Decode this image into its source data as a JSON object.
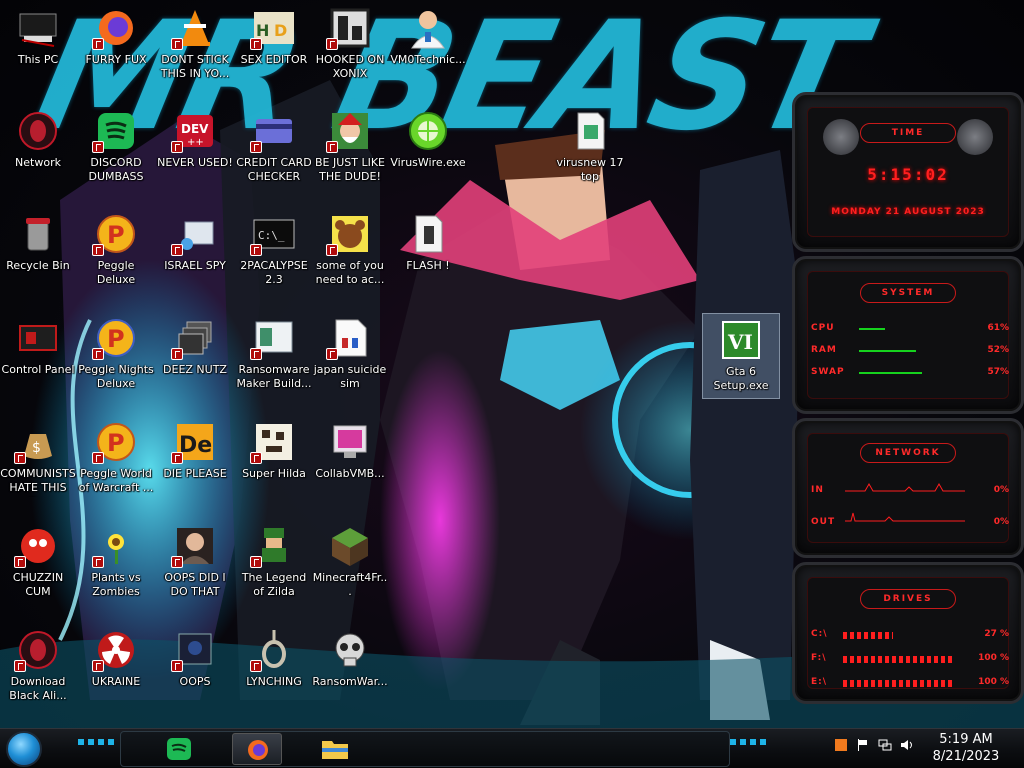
{
  "wallpaper": {
    "title": "MR BEAST"
  },
  "desktop": {
    "icons": [
      {
        "label": "This PC",
        "icon": "this-pc-icon",
        "shortcut": false
      },
      {
        "label": "FURRY FUX",
        "icon": "firefox-icon",
        "shortcut": true
      },
      {
        "label": "DONT STICK THIS IN YO...",
        "icon": "vlc-cone-icon",
        "shortcut": true
      },
      {
        "label": "SEX EDITOR",
        "icon": "hxd-hex-editor-icon",
        "shortcut": true
      },
      {
        "label": "HOOKED ON XONIX",
        "icon": "xonix-game-icon",
        "shortcut": true
      },
      {
        "label": "VM0Technic...",
        "icon": "doctor-avatar-icon",
        "shortcut": false
      },
      {
        "label": "Network",
        "icon": "network-alien-icon",
        "shortcut": false
      },
      {
        "label": "DISCORD DUMBASS",
        "icon": "spotify-icon",
        "shortcut": true
      },
      {
        "label": "NEVER USED!",
        "icon": "dev-cpp-icon",
        "shortcut": true
      },
      {
        "label": "CREDIT CARD CHECKER",
        "icon": "credit-card-icon",
        "shortcut": true
      },
      {
        "label": "BE JUST LIKE THE DUDE!",
        "icon": "santa-icon",
        "shortcut": true
      },
      {
        "label": "VirusWire.exe",
        "icon": "limewire-icon",
        "shortcut": false
      },
      {
        "label": "virusnew 17 top",
        "icon": "file-icon",
        "shortcut": false
      },
      {
        "label": "Recycle Bin",
        "icon": "recycle-bin-icon",
        "shortcut": false
      },
      {
        "label": "Peggle Deluxe",
        "icon": "peggle-icon",
        "shortcut": true
      },
      {
        "label": "ISRAEL SPY",
        "icon": "network-folder-icon",
        "shortcut": true
      },
      {
        "label": "2PACALYPSE 2.3",
        "icon": "cmd-console-icon",
        "shortcut": true
      },
      {
        "label": "some of you need to ac...",
        "icon": "bear-icon",
        "shortcut": true
      },
      {
        "label": "FLASH !",
        "icon": "file-icon",
        "shortcut": false
      },
      {
        "label": "Control Panel",
        "icon": "control-panel-icon",
        "shortcut": false
      },
      {
        "label": "Peggle Nights Deluxe",
        "icon": "peggle-icon",
        "shortcut": true
      },
      {
        "label": "DEEZ NUTZ",
        "icon": "stacked-windows-icon",
        "shortcut": true
      },
      {
        "label": "Ransomware Maker Build...",
        "icon": "window-app-icon",
        "shortcut": true
      },
      {
        "label": "japan suicide sim",
        "icon": "installer-icon",
        "shortcut": true
      },
      {
        "label": "Gta 6 Setup.exe",
        "icon": "gta-vi-icon",
        "shortcut": false
      },
      {
        "label": "COMMUNISTS HATE THIS G...",
        "icon": "money-bag-icon",
        "shortcut": true
      },
      {
        "label": "Peggle World of Warcraft ...",
        "icon": "peggle-icon",
        "shortcut": true
      },
      {
        "label": "DIE PLEASE",
        "icon": "de-app-icon",
        "shortcut": true
      },
      {
        "label": "Super Hilda",
        "icon": "pixel-sprite-icon",
        "shortcut": true
      },
      {
        "label": "CollabVMB...",
        "icon": "monitor-app-icon",
        "shortcut": false
      },
      {
        "label": "CHUZZIN CUM",
        "icon": "chuzzle-icon",
        "shortcut": true
      },
      {
        "label": "Plants vs Zombies",
        "icon": "flower-icon",
        "shortcut": true
      },
      {
        "label": "OOPS DID I DO THAT",
        "icon": "portrait-icon",
        "shortcut": true
      },
      {
        "label": "The Legend of Zilda",
        "icon": "pixel-hero-icon",
        "shortcut": true
      },
      {
        "label": "Minecraft4Fr...",
        "icon": "minecraft-block-icon",
        "shortcut": false
      },
      {
        "label": "Download Black Ali...",
        "icon": "network-alien-icon",
        "shortcut": true
      },
      {
        "label": "UKRAINE",
        "icon": "radiation-icon",
        "shortcut": true
      },
      {
        "label": "OOPS",
        "icon": "dark-window-icon",
        "shortcut": true
      },
      {
        "label": "LYNCHING",
        "icon": "noose-icon",
        "shortcut": true
      },
      {
        "label": "RansomWar...",
        "icon": "skull-icon",
        "shortcut": false
      }
    ]
  },
  "gadgets": {
    "time": {
      "title": "TIME",
      "clock": "5:15:02",
      "date": "MONDAY 21 AUGUST 2023"
    },
    "system": {
      "title": "SYSTEM",
      "rows": [
        {
          "label": "CPU",
          "value": "61%",
          "level": 0.24
        },
        {
          "label": "RAM",
          "value": "52%",
          "level": 0.52
        },
        {
          "label": "SWAP",
          "value": "57%",
          "level": 0.57
        }
      ]
    },
    "network": {
      "title": "NETWORK",
      "rows": [
        {
          "label": "IN",
          "value": "0%"
        },
        {
          "label": "OUT",
          "value": "0%"
        }
      ]
    },
    "drives": {
      "title": "DRIVES",
      "rows": [
        {
          "label": "C:\\",
          "value": "27 %"
        },
        {
          "label": "F:\\",
          "value": "100 %"
        },
        {
          "label": "E:\\",
          "value": "100 %"
        }
      ]
    }
  },
  "taskbar": {
    "pinned": [
      "spotify-icon",
      "firefox-icon",
      "file-explorer-icon"
    ],
    "tray": [
      "tray-app-icon",
      "flag-icon",
      "network-tray-icon",
      "volume-icon"
    ],
    "time": "5:19 AM",
    "date": "8/21/2023"
  },
  "colors": {
    "accent": "#23b6d6",
    "gadget_red": "#ff1f1f",
    "bar_green": "#16d21e",
    "selection": "#8caac8"
  }
}
